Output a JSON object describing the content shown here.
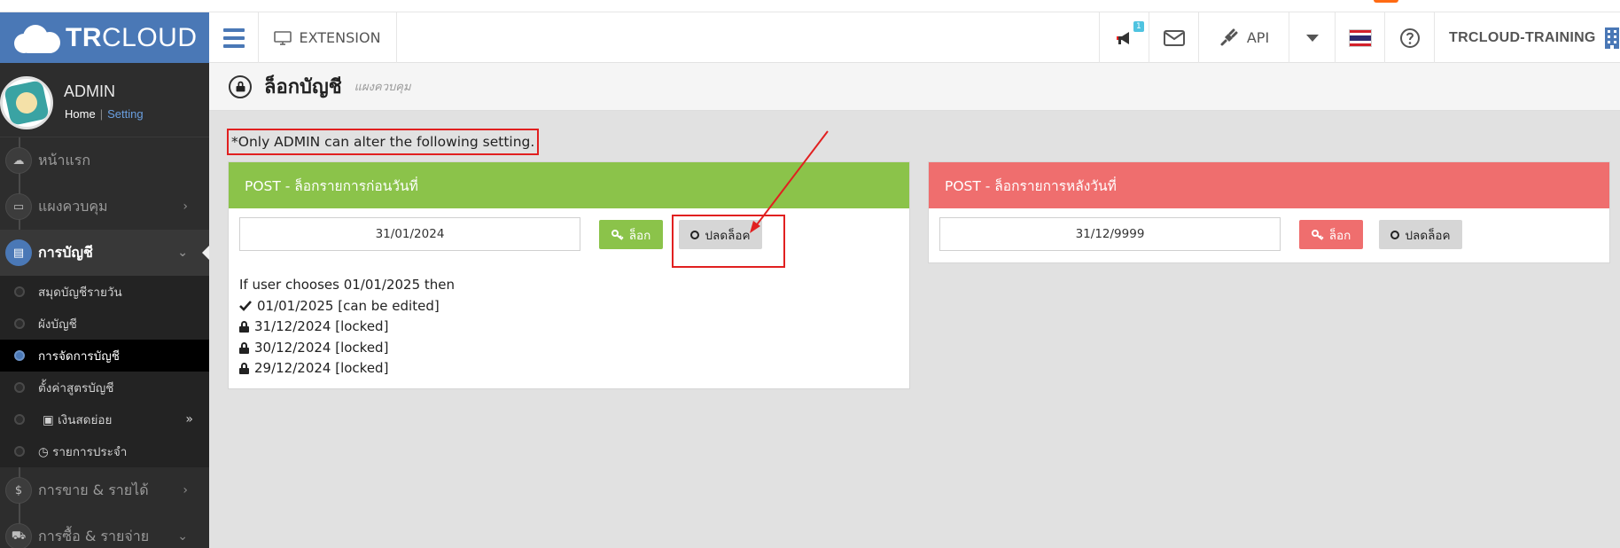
{
  "header": {
    "logo_bold": "TR",
    "logo_light": "CLOUD",
    "extension_label": "EXTENSION",
    "notification_count": "1",
    "api_label": "API",
    "company_name": "TRCLOUD-TRAINING"
  },
  "profile": {
    "name": "ADMIN",
    "home_link": "Home",
    "separator": "|",
    "setting_link": "Setting"
  },
  "sidebar": {
    "items": [
      {
        "label": "หน้าแรก",
        "icon": "cloud-icon"
      },
      {
        "label": "แผงควบคุม",
        "icon": "monitor-icon"
      },
      {
        "label": "การบัญชี",
        "icon": "book-icon"
      }
    ],
    "sub_items": [
      {
        "label": "สมุดบัญชีรายวัน"
      },
      {
        "label": "ผังบัญชี"
      },
      {
        "label": "การจัดการบัญชี"
      },
      {
        "label": "ตั้งค่าสูตรบัญชี"
      },
      {
        "label": "เงินสดย่อย",
        "icon": "id-card-icon"
      },
      {
        "label": "รายการประจำ",
        "icon": "clock-icon"
      }
    ],
    "more_items": [
      {
        "label": "การขาย & รายได้",
        "icon": "dollar-icon"
      },
      {
        "label": "การซื้อ & รายจ่าย",
        "icon": "cart-icon"
      }
    ]
  },
  "page": {
    "title": "ล็อกบัญชี",
    "subtitle": "แผงควบคุม",
    "notice": "*Only ADMIN can alter the following setting."
  },
  "lock_before": {
    "title": "POST - ล็อกรายการก่อนวันที่",
    "date_value": "31/01/2024",
    "lock_label": "ล็อก",
    "unlock_label": "ปลดล็อค",
    "explain_intro": "If user chooses 01/01/2025 then",
    "explain_rows": [
      {
        "text": "01/01/2025 [can be edited]",
        "icon": "check-icon"
      },
      {
        "text": "31/12/2024 [locked]",
        "icon": "lock-icon"
      },
      {
        "text": "30/12/2024 [locked]",
        "icon": "lock-icon"
      },
      {
        "text": "29/12/2024 [locked]",
        "icon": "lock-icon"
      }
    ]
  },
  "lock_after": {
    "title": "POST - ล็อกรายการหลังวันที่",
    "date_value": "31/12/9999",
    "lock_label": "ล็อก",
    "unlock_label": "ปลดล็อค"
  },
  "colors": {
    "brand_blue": "#4a78b6",
    "green_header": "#8bc34a",
    "red_header": "#ef6e6e",
    "annotation_red": "#e12020"
  }
}
